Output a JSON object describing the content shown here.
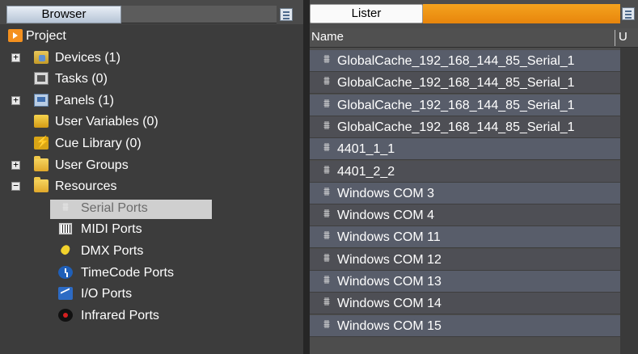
{
  "browser": {
    "tab_label": "Browser",
    "tree": [
      {
        "label": "Project",
        "icon": "project-icon",
        "expander": ""
      },
      {
        "label": "Devices (1)",
        "icon": "devices-icon",
        "expander": "+"
      },
      {
        "label": "Tasks (0)",
        "icon": "tasks-icon",
        "expander": ""
      },
      {
        "label": "Panels (1)",
        "icon": "panels-icon",
        "expander": "+"
      },
      {
        "label": "User Variables (0)",
        "icon": "user-variables-icon",
        "expander": ""
      },
      {
        "label": "Cue Library (0)",
        "icon": "cue-library-icon",
        "expander": ""
      },
      {
        "label": "User Groups",
        "icon": "folder-icon",
        "expander": "+"
      },
      {
        "label": "Resources",
        "icon": "folder-icon",
        "expander": "−"
      },
      {
        "label": "Serial Ports",
        "icon": "serial-port-icon",
        "expander": "",
        "selected": true
      },
      {
        "label": "MIDI Ports",
        "icon": "midi-port-icon",
        "expander": ""
      },
      {
        "label": "DMX Ports",
        "icon": "dmx-port-icon",
        "expander": ""
      },
      {
        "label": "TimeCode Ports",
        "icon": "timecode-port-icon",
        "expander": ""
      },
      {
        "label": "I/O Ports",
        "icon": "io-port-icon",
        "expander": ""
      },
      {
        "label": "Infrared Ports",
        "icon": "infrared-port-icon",
        "expander": ""
      }
    ]
  },
  "lister": {
    "tab_label": "Lister",
    "columns": {
      "name": "Name",
      "u": "U"
    },
    "ports": [
      "GlobalCache_192_168_144_85_Serial_1",
      "GlobalCache_192_168_144_85_Serial_1",
      "GlobalCache_192_168_144_85_Serial_1",
      "GlobalCache_192_168_144_85_Serial_1",
      "4401_1_1",
      "4401_2_2",
      "Windows COM 3",
      "Windows COM 4",
      "Windows COM 11",
      "Windows COM 12",
      "Windows COM 13",
      "Windows COM 14",
      "Windows COM 15"
    ]
  },
  "colors": {
    "accent": "#f0961a",
    "selection": "#cfcfcf",
    "background": "#404040"
  }
}
